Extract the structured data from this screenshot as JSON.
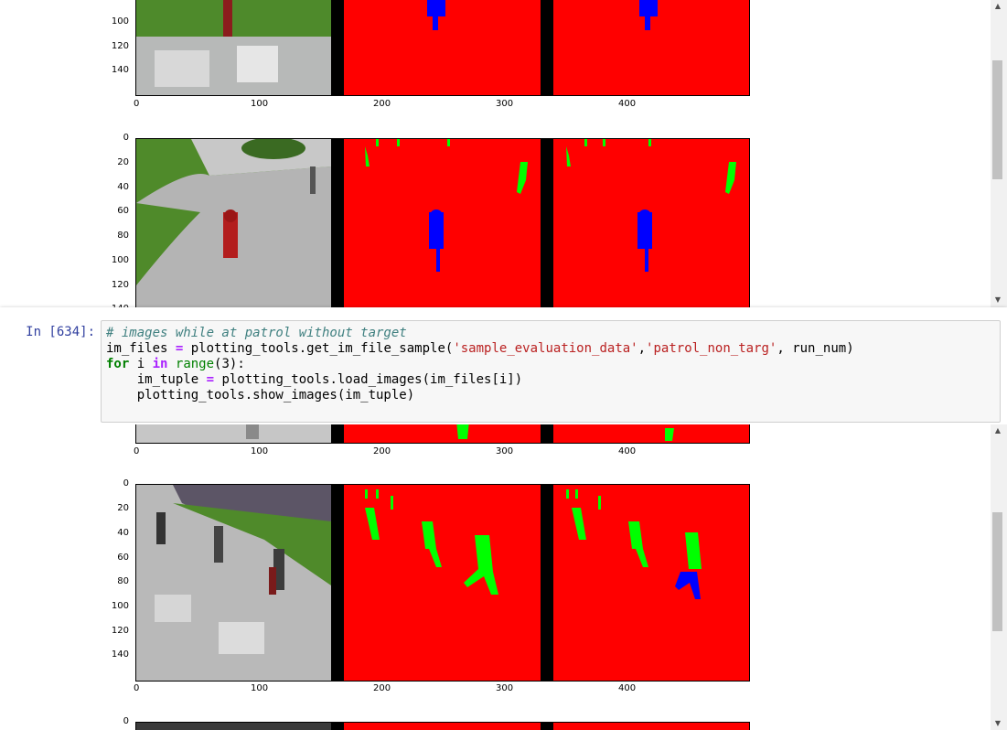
{
  "cell": {
    "prompt": "In [634]:",
    "code": {
      "comment": "# images while at patrol without target",
      "line2_a": "im_files ",
      "line2_eq": "=",
      "line2_b": " plotting_tools.get_im_file_sample(",
      "line2_s1": "'sample_evaluation_data'",
      "line2_c": ",",
      "line2_s2": "'patrol_non_targ'",
      "line2_d": ", run_num)",
      "line3_for": "for",
      "line3_a": " i ",
      "line3_in": "in",
      "line3_sp": " ",
      "line3_range": "range",
      "line3_b": "(3):",
      "line4_a": "    im_tuple ",
      "line4_eq": "=",
      "line4_b": " plotting_tools.load_images(im_files[i])",
      "line5": "    plotting_tools.show_images(im_tuple)"
    }
  },
  "plots": {
    "x_ticks": [
      "0",
      "100",
      "200",
      "300",
      "400"
    ],
    "y_ticks_full": [
      "0",
      "20",
      "40",
      "60",
      "80",
      "100",
      "120",
      "140"
    ],
    "y_ticks_top_partial": [
      "100",
      "120",
      "140"
    ],
    "y_ticks_bottom_partial": [
      "0"
    ]
  },
  "colors": {
    "mask_red": "#ff0000",
    "mask_green": "#00ff00",
    "mask_blue": "#0000ff",
    "separator_black": "#000000",
    "prompt_blue": "#303f9f"
  }
}
